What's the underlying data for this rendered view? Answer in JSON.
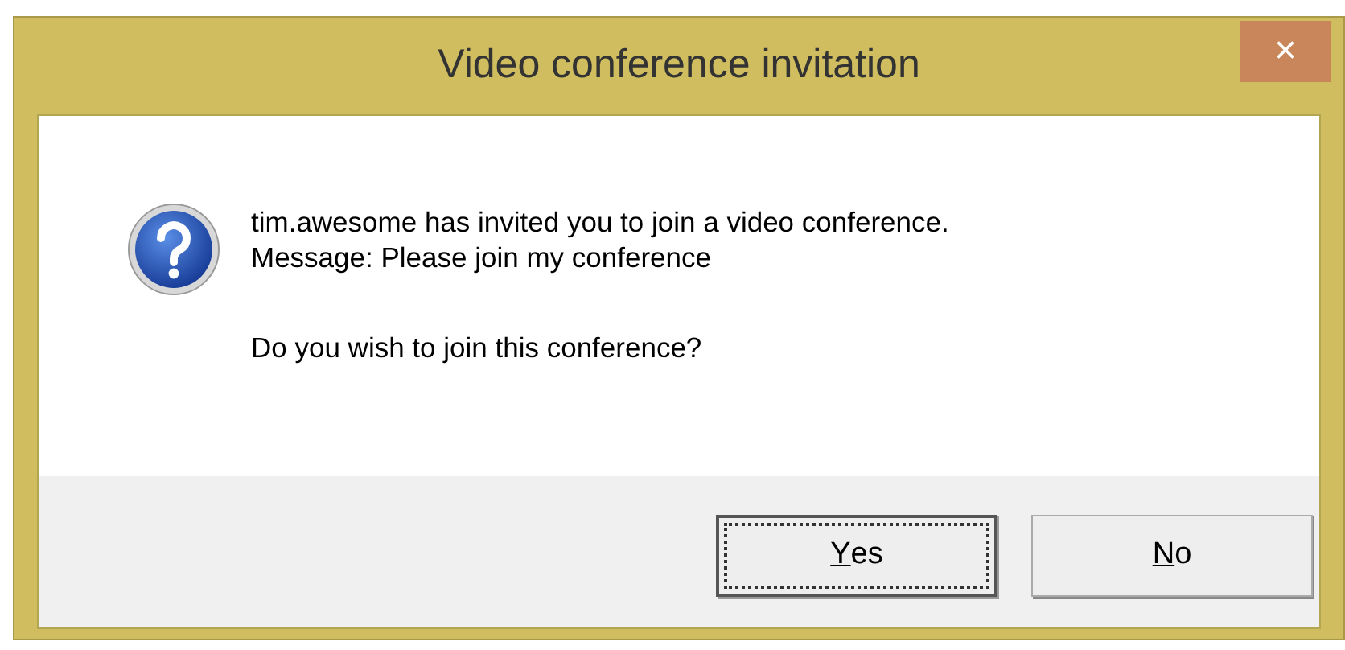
{
  "window": {
    "title": "Video conference invitation",
    "close_button": "×"
  },
  "message": {
    "lines": [
      "tim.awesome has invited you to join a video conference.",
      "Message: Please join my conference"
    ],
    "question": "Do you wish to join this conference?"
  },
  "buttons": [
    {
      "label": "Yes",
      "first_letter_underlined": true,
      "focused": true
    },
    {
      "label": "No",
      "first_letter_underlined": true,
      "focused": false
    }
  ]
}
